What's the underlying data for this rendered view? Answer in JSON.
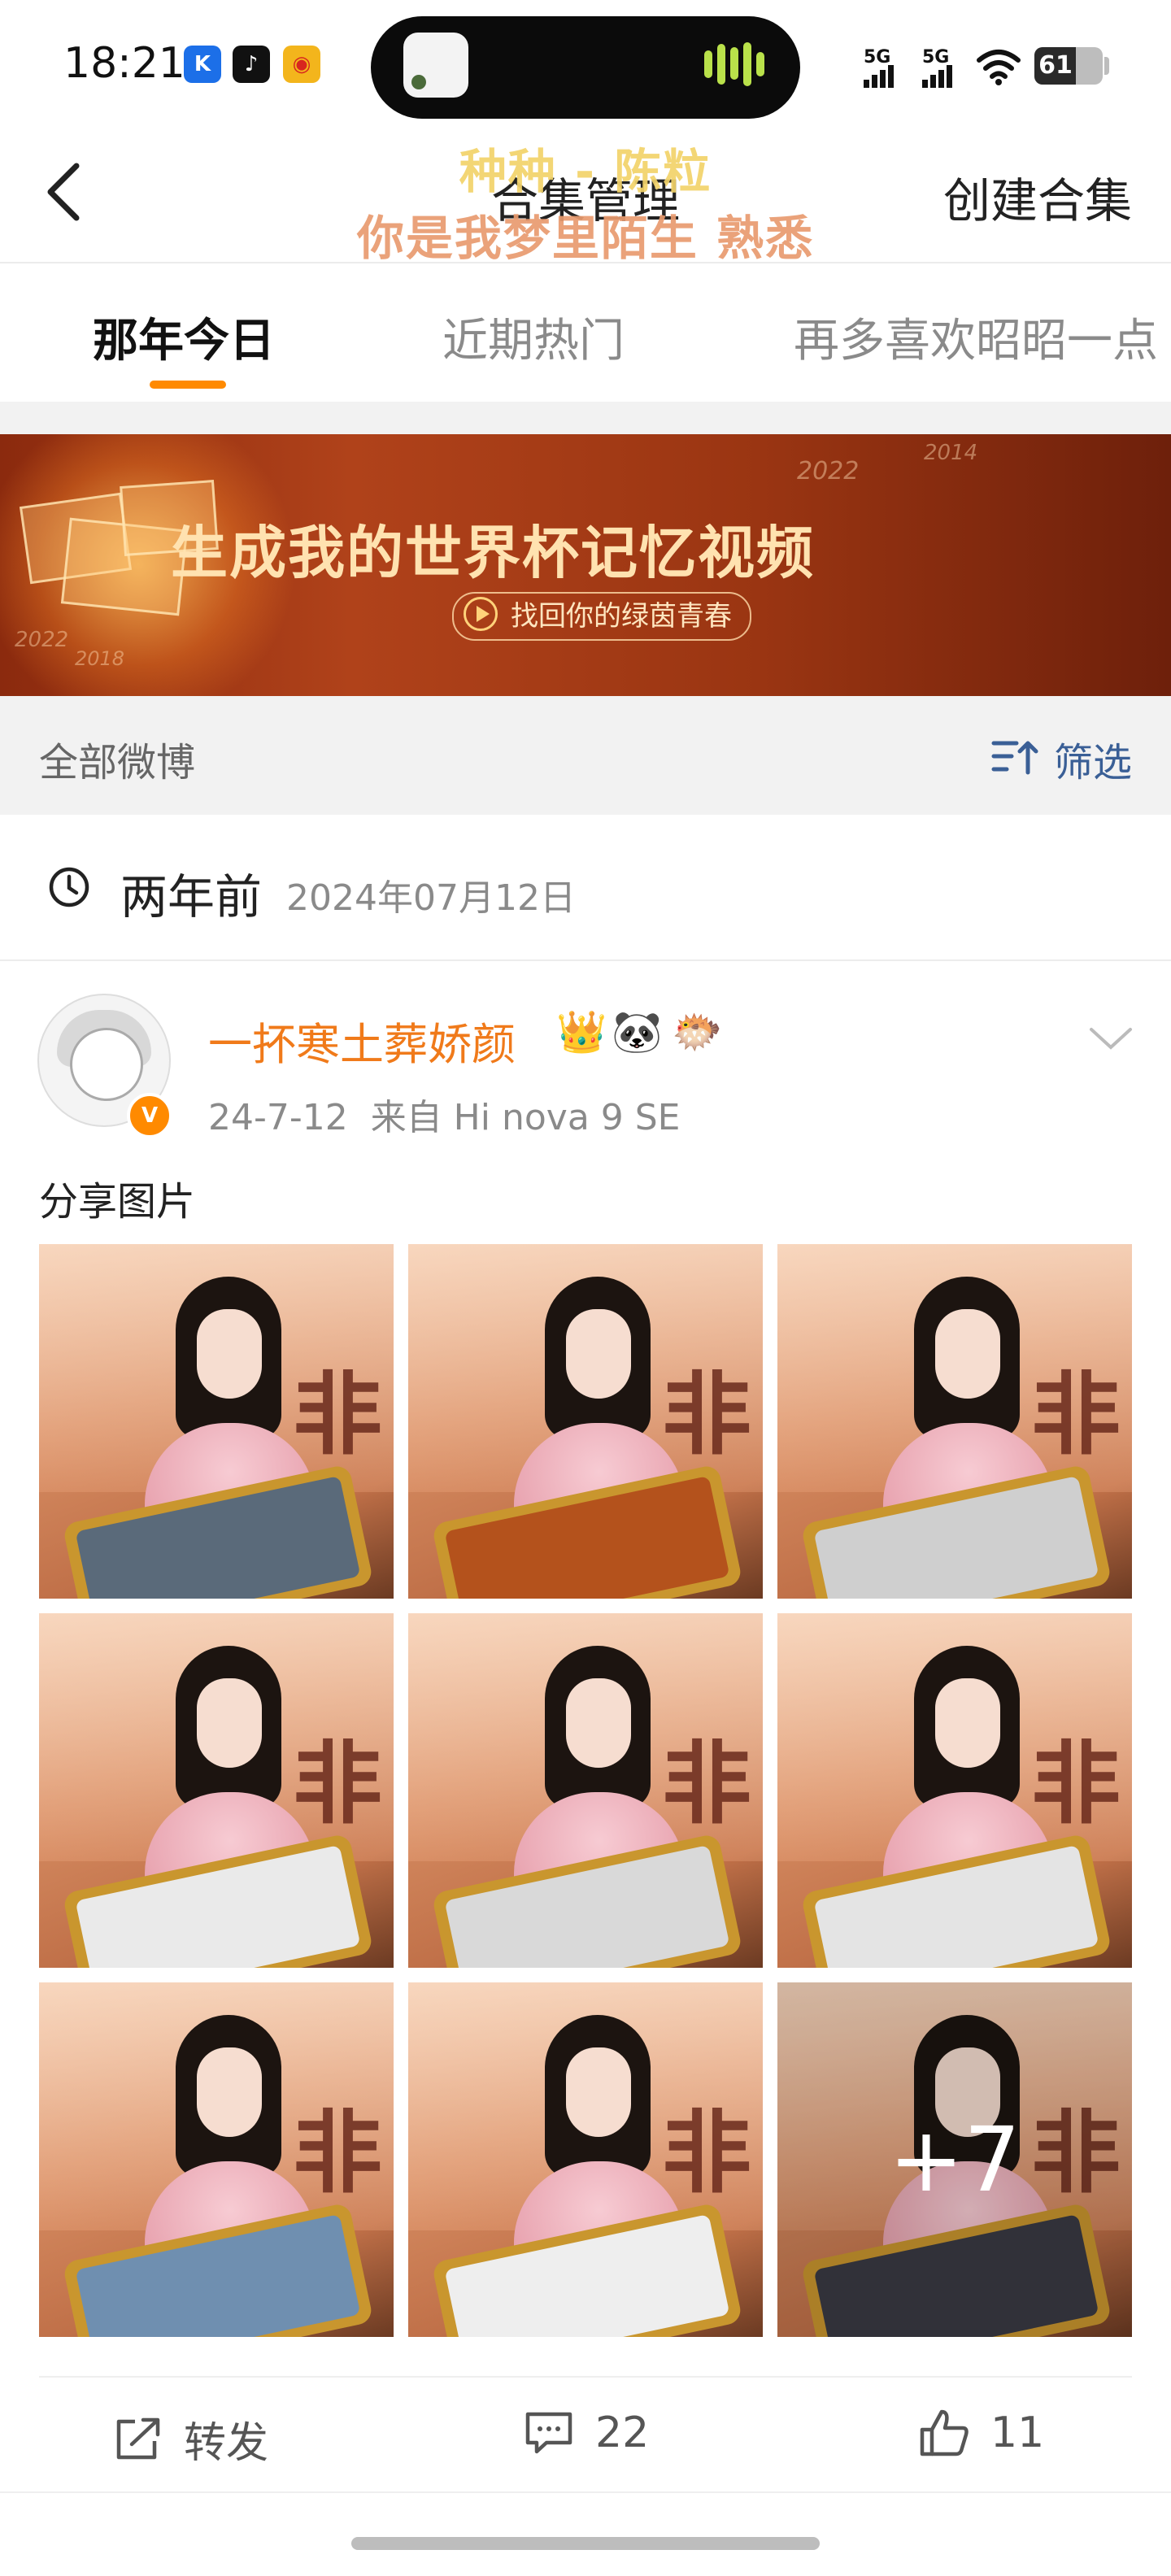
{
  "status": {
    "time": "18:21",
    "signal1": "5G",
    "signal2": "5G",
    "battery": "61",
    "app_icons": [
      "k-app-icon",
      "tiktok-icon",
      "weibo-icon"
    ]
  },
  "overlay_lyrics": {
    "line1": "种种 - 陈粒",
    "line2": "你是我梦里陌生 熟悉"
  },
  "nav": {
    "title": "合集管理",
    "create": "创建合集"
  },
  "tabs": [
    {
      "label": "那年今日",
      "active": true
    },
    {
      "label": "近期热门",
      "active": false
    },
    {
      "label": "再多喜欢昭昭一点",
      "active": false
    }
  ],
  "banner": {
    "title": "生成我的世界杯记忆视频",
    "cta": "找回你的绿茵青春",
    "years": [
      "2022",
      "2014",
      "2022",
      "2018"
    ]
  },
  "filter": {
    "label": "全部微博",
    "action": "筛选"
  },
  "date": {
    "relative": "两年前",
    "absolute": "2024年07月12日"
  },
  "post": {
    "username": "一抔寒土葬娇颜",
    "emojis": [
      "👑",
      "🐼",
      "🐡"
    ],
    "verified_badge": "V",
    "meta": "24-7-12  来自 Hi nova 9 SE",
    "text": "分享图片",
    "sign_char": "非",
    "more_photos": "+7",
    "photo_count_shown": 9,
    "actions": {
      "repost": "转发",
      "comments": "22",
      "likes": "11"
    }
  },
  "colors": {
    "accent": "#ff8a00",
    "username": "#f07a1a",
    "link_blue": "#3a5f96"
  }
}
